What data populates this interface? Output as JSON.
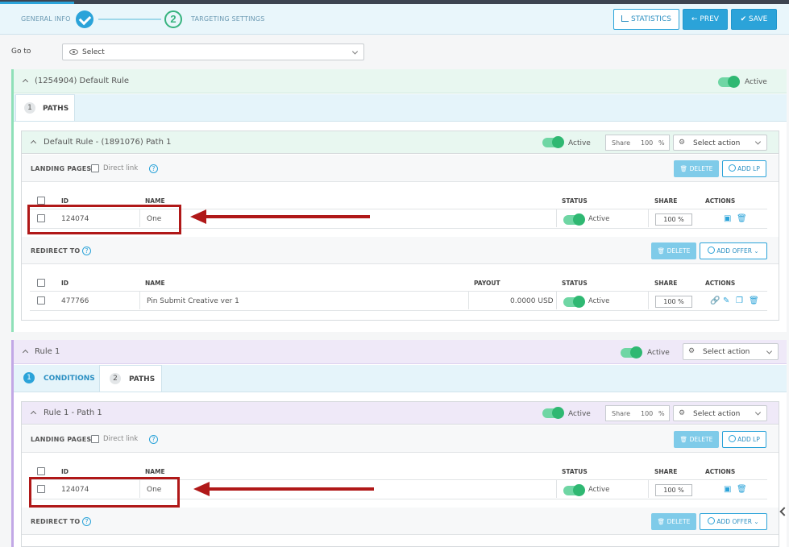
{
  "header": {
    "step1_label": "GENERAL INFO",
    "step2_number": "2",
    "step2_label": "TARGETING SETTINGS",
    "statistics_label": "STATISTICS",
    "prev_label": "← PREV",
    "save_label": "SAVE"
  },
  "goto": {
    "label": "Go to",
    "value": "Select"
  },
  "rules": [
    {
      "title": "(1254904) Default Rule",
      "status": "Active",
      "tabs": [
        {
          "num": "1",
          "label": "PATHS"
        }
      ],
      "path": {
        "title": "Default Rule - (1891076) Path 1",
        "status": "Active",
        "share_label": "Share",
        "share_value": "100",
        "share_unit": "%",
        "action_select": "Select action",
        "landing_pages": {
          "label": "LANDING PAGES",
          "direct_link": "Direct link",
          "delete_label": "DELETE",
          "add_label": "ADD LP",
          "columns": {
            "id": "ID",
            "name": "NAME",
            "status": "STATUS",
            "share": "SHARE",
            "actions": "ACTIONS"
          },
          "rows": [
            {
              "id": "124074",
              "name": "One",
              "status": "Active",
              "share": "100 %"
            }
          ]
        },
        "redirect": {
          "label": "REDIRECT TO",
          "delete_label": "DELETE",
          "add_label": "ADD OFFER",
          "columns": {
            "id": "ID",
            "name": "NAME",
            "payout": "PAYOUT",
            "status": "STATUS",
            "share": "SHARE",
            "actions": "ACTIONS"
          },
          "rows": [
            {
              "id": "477766",
              "name": "Pin Submit Creative ver 1",
              "payout": "0.0000 USD",
              "status": "Active",
              "share": "100 %"
            }
          ]
        }
      }
    },
    {
      "title": "Rule 1",
      "status": "Active",
      "action_select": "Select action",
      "tabs": [
        {
          "num": "1",
          "label": "CONDITIONS"
        },
        {
          "num": "2",
          "label": "PATHS"
        }
      ],
      "path": {
        "title": "Rule 1 - Path 1",
        "status": "Active",
        "share_label": "Share",
        "share_value": "100",
        "share_unit": "%",
        "action_select": "Select action",
        "landing_pages": {
          "label": "LANDING PAGES",
          "direct_link": "Direct link",
          "delete_label": "DELETE",
          "add_label": "ADD LP",
          "columns": {
            "id": "ID",
            "name": "NAME",
            "status": "STATUS",
            "share": "SHARE",
            "actions": "ACTIONS"
          },
          "rows": [
            {
              "id": "124074",
              "name": "One",
              "status": "Active",
              "share": "100 %"
            }
          ]
        },
        "redirect": {
          "label": "REDIRECT TO",
          "delete_label": "DELETE",
          "add_label": "ADD OFFER"
        }
      }
    }
  ],
  "colors": {
    "accent": "#2ba3d9",
    "active_green": "#2fb872",
    "annotation_red": "#b01818",
    "rule_default_bg": "#e8f7f0",
    "rule_purple_bg": "#efe9f8"
  }
}
